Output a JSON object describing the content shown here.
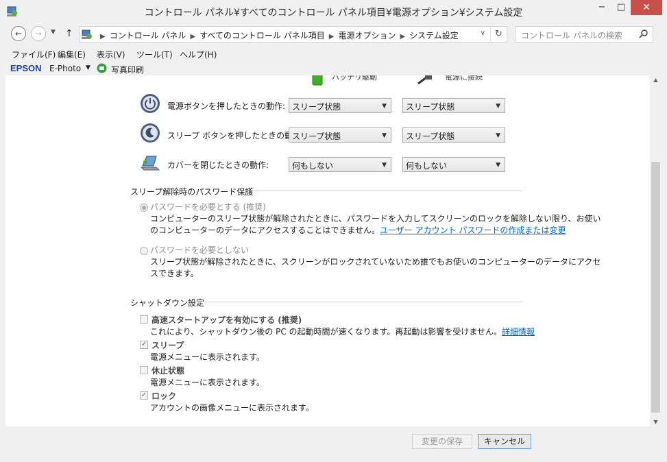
{
  "window": {
    "title": "コントロール パネル¥すべてのコントロール パネル項目¥電源オプション¥システム設定",
    "min_glyph": "−",
    "max_glyph": "□",
    "close_glyph": "✕"
  },
  "address": {
    "breadcrumbs": [
      "コントロール パネル",
      "すべてのコントロール パネル項目",
      "電源オプション",
      "システム設定"
    ],
    "search_placeholder": "コントロール パネルの検索"
  },
  "menu": {
    "file": "ファイル(F)",
    "edit": "編集(E)",
    "view": "表示(V)",
    "tools": "ツール(T)",
    "help": "ヘルプ(H)"
  },
  "epson": {
    "logo": "EPSON",
    "ephoto": "E-Photo",
    "print_label": "写真印刷"
  },
  "columns": {
    "battery": "バッテリ駆動",
    "plugged": "電源に接続"
  },
  "actions": [
    {
      "label": "電源ボタンを押したときの動作:",
      "battery": "スリープ状態",
      "plugged": "スリープ状態"
    },
    {
      "label": "スリープ ボタンを押したときの動作:",
      "battery": "スリープ状態",
      "plugged": "スリープ状態"
    },
    {
      "label": "カバーを閉じたときの動作:",
      "battery": "何もしない",
      "plugged": "何もしない"
    }
  ],
  "password_section": {
    "title": "スリープ解除時のパスワード保護",
    "require_label": "パスワードを必要とする (推奨)",
    "require_desc_1": "コンピューターのスリープ状態が解除されたときに、パスワードを入力してスクリーンのロックを解除しない限り、お使い",
    "require_desc_2": "のコンピューターのデータにアクセスすることはできません。",
    "require_link": "ユーザー アカウント パスワードの作成または変更",
    "norequire_label": "パスワードを必要としない",
    "norequire_desc_1": "スリープ状態が解除されたときに、スクリーンがロックされていないため誰でもお使いのコンピューターのデータにアクセ",
    "norequire_desc_2": "スできます。"
  },
  "shutdown_section": {
    "title": "シャットダウン設定",
    "items": [
      {
        "label": "高速スタートアップを有効にする (推奨)",
        "desc": "これにより、シャットダウン後の PC の起動時間が速くなります。再起動は影響を受けません。",
        "link": "詳細情報",
        "checked": false
      },
      {
        "label": "スリープ",
        "desc": "電源メニューに表示されます。",
        "checked": true
      },
      {
        "label": "休止状態",
        "desc": "電源メニューに表示されます。",
        "checked": false
      },
      {
        "label": "ロック",
        "desc": "アカウントの画像メニューに表示されます。",
        "checked": true
      }
    ]
  },
  "footer": {
    "save": "変更の保存",
    "cancel": "キャンセル"
  },
  "colors": {
    "link": "#0066cc",
    "close_button": "#c7504b",
    "epson_blue": "#1b3f9c"
  }
}
